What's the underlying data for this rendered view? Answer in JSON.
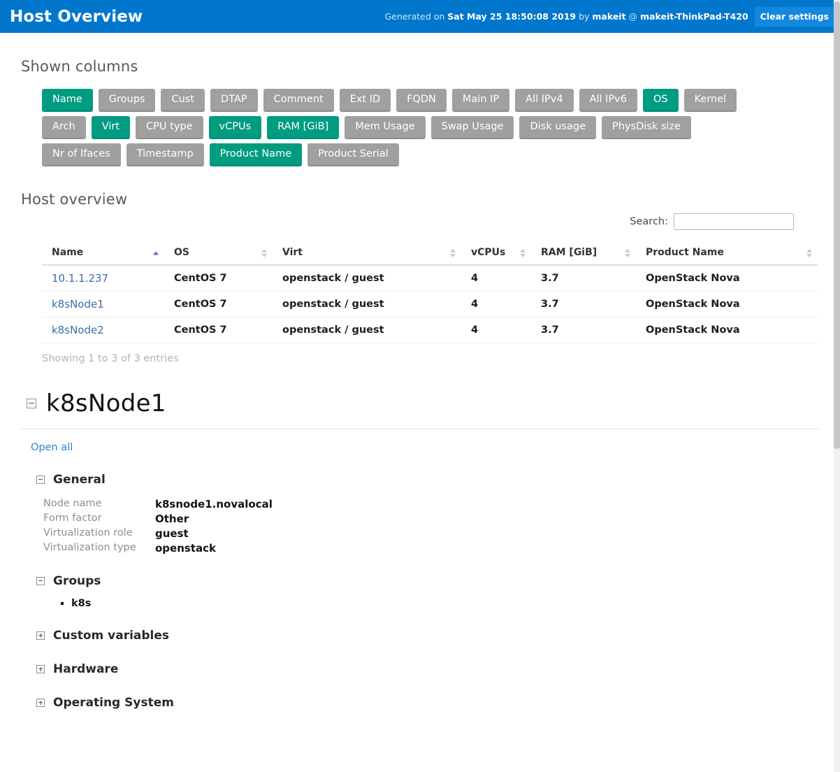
{
  "header": {
    "title": "Host Overview",
    "generated_prefix": "Generated on ",
    "generated_timestamp": "Sat May 25 18:50:08 2019",
    "generated_by_label": " by ",
    "generated_user": "makeit",
    "generated_at": " @ ",
    "generated_host": "makeit-ThinkPad-T420",
    "clear_settings_label": "Clear settings",
    "bar_color": "#0077cc",
    "button_color": "#1488de"
  },
  "shown_columns": {
    "title": "Shown columns",
    "active_color": "#009c82",
    "inactive_color": "#a0a0a0",
    "rows": [
      [
        {
          "label": "Name",
          "active": true
        },
        {
          "label": "Groups",
          "active": false
        },
        {
          "label": "Cust",
          "active": false
        },
        {
          "label": "DTAP",
          "active": false
        },
        {
          "label": "Comment",
          "active": false
        },
        {
          "label": "Ext ID",
          "active": false
        },
        {
          "label": "FQDN",
          "active": false
        },
        {
          "label": "Main IP",
          "active": false
        },
        {
          "label": "All IPv4",
          "active": false
        },
        {
          "label": "All IPv6",
          "active": false
        },
        {
          "label": "OS",
          "active": true
        },
        {
          "label": "Kernel",
          "active": false
        }
      ],
      [
        {
          "label": "Arch",
          "active": false
        },
        {
          "label": "Virt",
          "active": true
        },
        {
          "label": "CPU type",
          "active": false
        },
        {
          "label": "vCPUs",
          "active": true
        },
        {
          "label": "RAM [GiB]",
          "active": true
        },
        {
          "label": "Mem Usage",
          "active": false
        },
        {
          "label": "Swap Usage",
          "active": false
        },
        {
          "label": "Disk usage",
          "active": false
        },
        {
          "label": "PhysDisk size",
          "active": false
        }
      ],
      [
        {
          "label": "Nr of Ifaces",
          "active": false
        },
        {
          "label": "Timestamp",
          "active": false
        },
        {
          "label": "Product Name",
          "active": true
        },
        {
          "label": "Product Serial",
          "active": false
        }
      ]
    ]
  },
  "host_overview": {
    "title": "Host overview",
    "search_label": "Search:",
    "search_value": "",
    "search_placeholder": "",
    "columns": [
      {
        "label": "Name",
        "sorted": "asc"
      },
      {
        "label": "OS",
        "sorted": "none"
      },
      {
        "label": "Virt",
        "sorted": "none"
      },
      {
        "label": "vCPUs",
        "sorted": "none"
      },
      {
        "label": "RAM [GiB]",
        "sorted": "none"
      },
      {
        "label": "Product Name",
        "sorted": "none"
      }
    ],
    "rows": [
      {
        "name": "10.1.1.237",
        "os": "CentOS 7",
        "virt": "openstack / guest",
        "vcpus": "4",
        "ram": "3.7",
        "product": "OpenStack Nova"
      },
      {
        "name": "k8sNode1",
        "os": "CentOS 7",
        "virt": "openstack / guest",
        "vcpus": "4",
        "ram": "3.7",
        "product": "OpenStack Nova"
      },
      {
        "name": "k8sNode2",
        "os": "CentOS 7",
        "virt": "openstack / guest",
        "vcpus": "4",
        "ram": "3.7",
        "product": "OpenStack Nova"
      }
    ],
    "showing_entries": "Showing 1 to 3 of 3 entries"
  },
  "host_detail": {
    "name": "k8sNode1",
    "open_all_label": "Open all",
    "general": {
      "title": "General",
      "properties": [
        {
          "key": "Node name",
          "value": "k8snode1.novalocal"
        },
        {
          "key": "Form factor",
          "value": "Other"
        },
        {
          "key": "Virtualization role",
          "value": "guest"
        },
        {
          "key": "Virtualization type",
          "value": "openstack"
        }
      ]
    },
    "groups": {
      "title": "Groups",
      "items": [
        "k8s"
      ]
    },
    "collapsed_sections": [
      {
        "title": "Custom variables"
      },
      {
        "title": "Hardware"
      },
      {
        "title": "Operating System"
      }
    ]
  }
}
